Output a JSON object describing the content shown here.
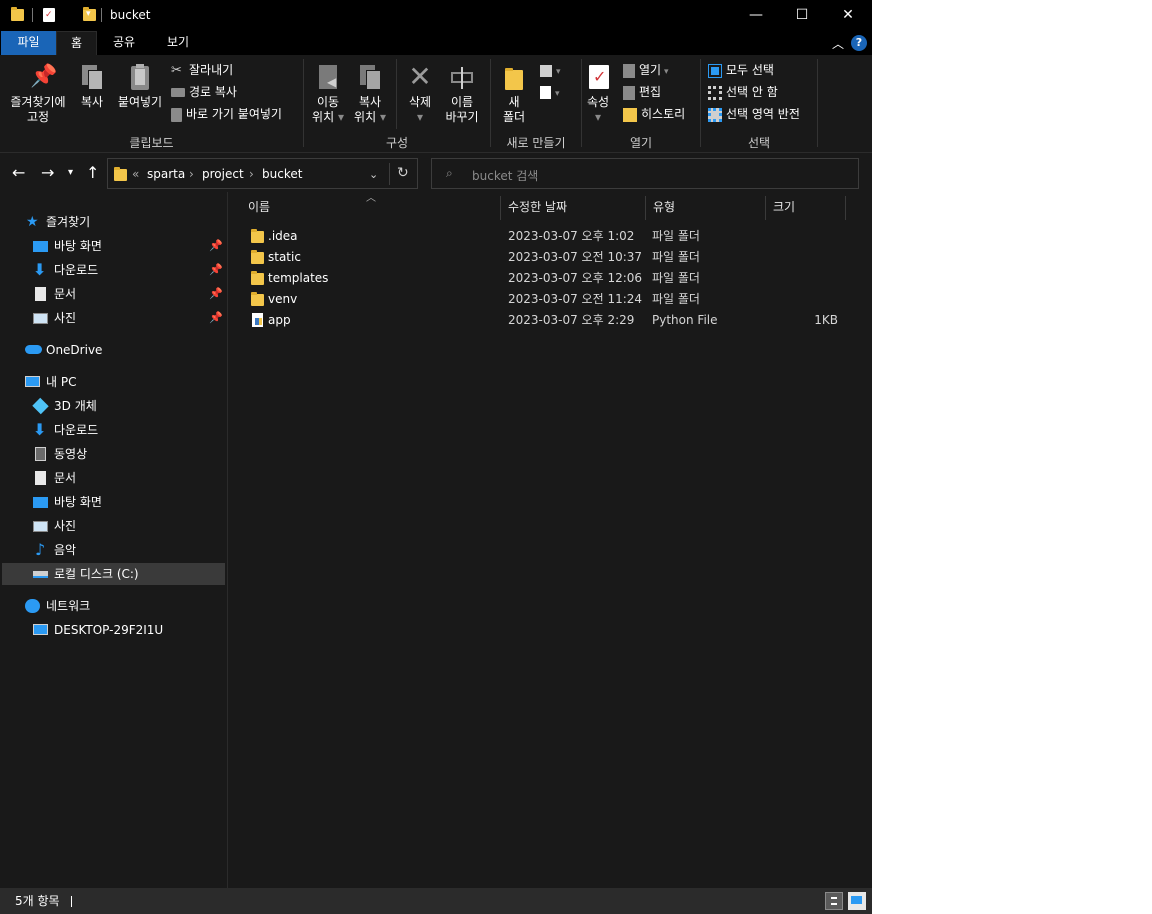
{
  "window": {
    "title": "bucket",
    "minimize_glyph": "—",
    "maximize_glyph": "☐",
    "close_glyph": "✕"
  },
  "ribbon_tabs": {
    "file": "파일",
    "home": "홈",
    "share": "공유",
    "view": "보기"
  },
  "ribbon": {
    "clipboard": {
      "pin": "즐겨찾기에",
      "pin2": "고정",
      "copy": "복사",
      "paste": "붙여넣기",
      "cut": "잘라내기",
      "copy_path": "경로 복사",
      "paste_shortcut": "바로 가기 붙여넣기",
      "label": "클립보드"
    },
    "organize": {
      "move_to": "이동",
      "move_to2": "위치",
      "copy_to": "복사",
      "copy_to2": "위치",
      "delete": "삭제",
      "rename": "이름",
      "rename2": "바꾸기",
      "label": "구성"
    },
    "new": {
      "new_folder": "새",
      "new_folder2": "폴더",
      "label": "새로 만들기"
    },
    "open": {
      "properties": "속성",
      "open": "열기",
      "edit": "편집",
      "history": "히스토리",
      "label": "열기"
    },
    "select": {
      "select_all": "모두 선택",
      "select_none": "선택 안 함",
      "invert": "선택 영역 반전",
      "label": "선택"
    }
  },
  "address": {
    "overflow": "«",
    "crumbs": [
      "sparta",
      "project",
      "bucket"
    ],
    "search_placeholder": "bucket 검색"
  },
  "nav": {
    "quick_access": "즐겨찾기",
    "quick_items": [
      "바탕 화면",
      "다운로드",
      "문서",
      "사진"
    ],
    "onedrive": "OneDrive",
    "this_pc": "내 PC",
    "pc_items": [
      "3D 개체",
      "다운로드",
      "동영상",
      "문서",
      "바탕 화면",
      "사진",
      "음악",
      "로컬 디스크 (C:)"
    ],
    "network": "네트워크",
    "network_items": [
      "DESKTOP-29F2I1U"
    ]
  },
  "columns": {
    "name": "이름",
    "modified": "수정한 날짜",
    "type": "유형",
    "size": "크기"
  },
  "files": [
    {
      "name": ".idea",
      "modified": "2023-03-07 오후 1:02",
      "type": "파일 폴더",
      "size": "",
      "icon": "folder-icon"
    },
    {
      "name": "static",
      "modified": "2023-03-07 오전 10:37",
      "type": "파일 폴더",
      "size": "",
      "icon": "folder-icon"
    },
    {
      "name": "templates",
      "modified": "2023-03-07 오후 12:06",
      "type": "파일 폴더",
      "size": "",
      "icon": "folder-icon"
    },
    {
      "name": "venv",
      "modified": "2023-03-07 오전 11:24",
      "type": "파일 폴더",
      "size": "",
      "icon": "folder-icon"
    },
    {
      "name": "app",
      "modified": "2023-03-07 오후 2:29",
      "type": "Python File",
      "size": "1KB",
      "icon": "python-file-icon"
    }
  ],
  "status": {
    "count": "5개 항목"
  },
  "colors": {
    "file_tab": "#1a65b7",
    "folder": "#f3c64a",
    "window_bg": "#191919",
    "selected": "#3a3a3a"
  }
}
